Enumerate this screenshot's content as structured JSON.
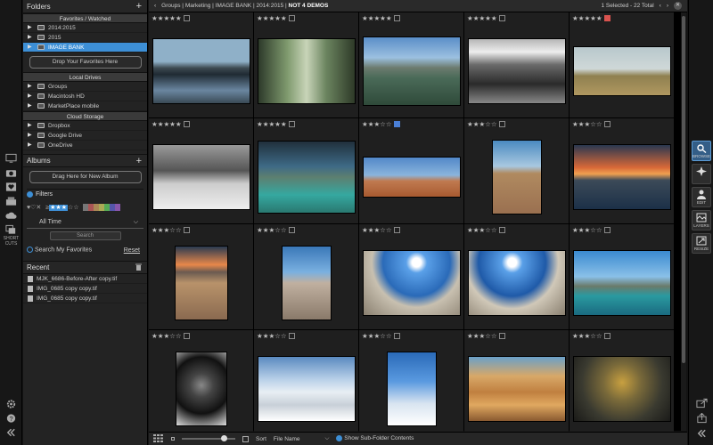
{
  "left_rail": {
    "shortcuts_label": "SHORT CUTS"
  },
  "folders": {
    "title": "Folders",
    "favorites_header": "Favorites / Watched",
    "favorites": [
      {
        "label": "2014:2015",
        "selected": false
      },
      {
        "label": "2015",
        "selected": false
      },
      {
        "label": "IMAGE BANK",
        "selected": true
      }
    ],
    "drop_favorites": "Drop Your Favorites Here",
    "local_header": "Local Drives",
    "local": [
      "Groups",
      "Macintosh HD",
      "MarketPlace mobile"
    ],
    "cloud_header": "Cloud Storage",
    "cloud": [
      "Dropbox",
      "Google Drive",
      "OneDrive"
    ]
  },
  "albums": {
    "title": "Albums",
    "drag_here": "Drag Here for New Album"
  },
  "filters": {
    "title": "Filters",
    "time": "All Time",
    "search_button": "Search",
    "search_favorites": "Search My Favorites",
    "reset": "Reset"
  },
  "recent": {
    "title": "Recent",
    "items": [
      "MJK_6686-Before-After copy.tif",
      "IMG_0685 copy copy.tif",
      "IMG_0685 copy copy.tif"
    ]
  },
  "topbar": {
    "crumbs": [
      "Groups",
      "Marketing",
      "IMAGE BANK",
      "2014:2015"
    ],
    "current": "NOT 4 DEMOS",
    "status": "1 Selected - 22 Total"
  },
  "bottombar": {
    "sort_label": "Sort",
    "sort_value": "File Name",
    "subfolder": "Show Sub-Folder Contents"
  },
  "right_rail": {
    "browse": "BROWSE",
    "edit": "EDIT",
    "layers": "LAYERS",
    "resize": "RESIZE"
  },
  "colors": {
    "accent": "#3d8fd6",
    "label_red": "#d9534f",
    "label_blue": "#4a7fd6"
  },
  "photos": [
    {
      "stars": 5,
      "label": "none"
    },
    {
      "stars": 5,
      "label": "none"
    },
    {
      "stars": 5,
      "label": "none"
    },
    {
      "stars": 5,
      "label": "none"
    },
    {
      "stars": 5,
      "label": "red"
    },
    {
      "stars": 5,
      "label": "none"
    },
    {
      "stars": 5,
      "label": "none"
    },
    {
      "stars": 3,
      "label": "blue"
    },
    {
      "stars": 3,
      "label": "none"
    },
    {
      "stars": 3,
      "label": "none"
    },
    {
      "stars": 3,
      "label": "none"
    },
    {
      "stars": 3,
      "label": "none"
    },
    {
      "stars": 3,
      "label": "none"
    },
    {
      "stars": 3,
      "label": "none"
    },
    {
      "stars": 3,
      "label": "none"
    },
    {
      "stars": 3,
      "label": "none"
    },
    {
      "stars": 3,
      "label": "none"
    },
    {
      "stars": 3,
      "label": "none"
    },
    {
      "stars": 3,
      "label": "none"
    },
    {
      "stars": 3,
      "label": "none"
    }
  ]
}
